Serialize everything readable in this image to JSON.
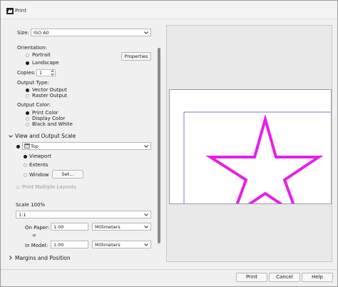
{
  "window": {
    "title": "Print"
  },
  "size": {
    "label": "Size:",
    "value": "ISO A0"
  },
  "orientation": {
    "label": "Orientation:",
    "portrait": "Portrait",
    "landscape": "Landscape",
    "selected": "landscape",
    "properties_button": "Properties"
  },
  "copies": {
    "label": "Copies:",
    "value": "1"
  },
  "output_type": {
    "label": "Output Type:",
    "vector": "Vector Output",
    "raster": "Raster Output",
    "selected": "vector"
  },
  "output_color": {
    "label": "Output Color:",
    "print": "Print Color",
    "display": "Display Color",
    "bw": "Black and White",
    "selected": "print"
  },
  "view_scale": {
    "header": "View and Output Scale",
    "view": "Top",
    "viewport": "Viewport",
    "extents": "Extents",
    "window": "Window",
    "set_button": "Set...",
    "selected": "viewport",
    "multiple_layouts": "Print Multiple Layouts"
  },
  "scale": {
    "label": "Scale 100%",
    "ratio": "1:1",
    "on_paper_label": "On Paper:",
    "on_paper_value": "1.00",
    "on_paper_unit": "Millimeters",
    "equals": "=",
    "in_model_label": "In Model:",
    "in_model_value": "1.00",
    "in_model_unit": "Millimeters"
  },
  "margins": {
    "header": "Margins and Position"
  },
  "footer": {
    "print": "Print",
    "cancel": "Cancel",
    "help": "Help"
  },
  "colors": {
    "star": "#e81ee8",
    "frame": "#5b5bb5",
    "accent": "#1a1a1a"
  }
}
